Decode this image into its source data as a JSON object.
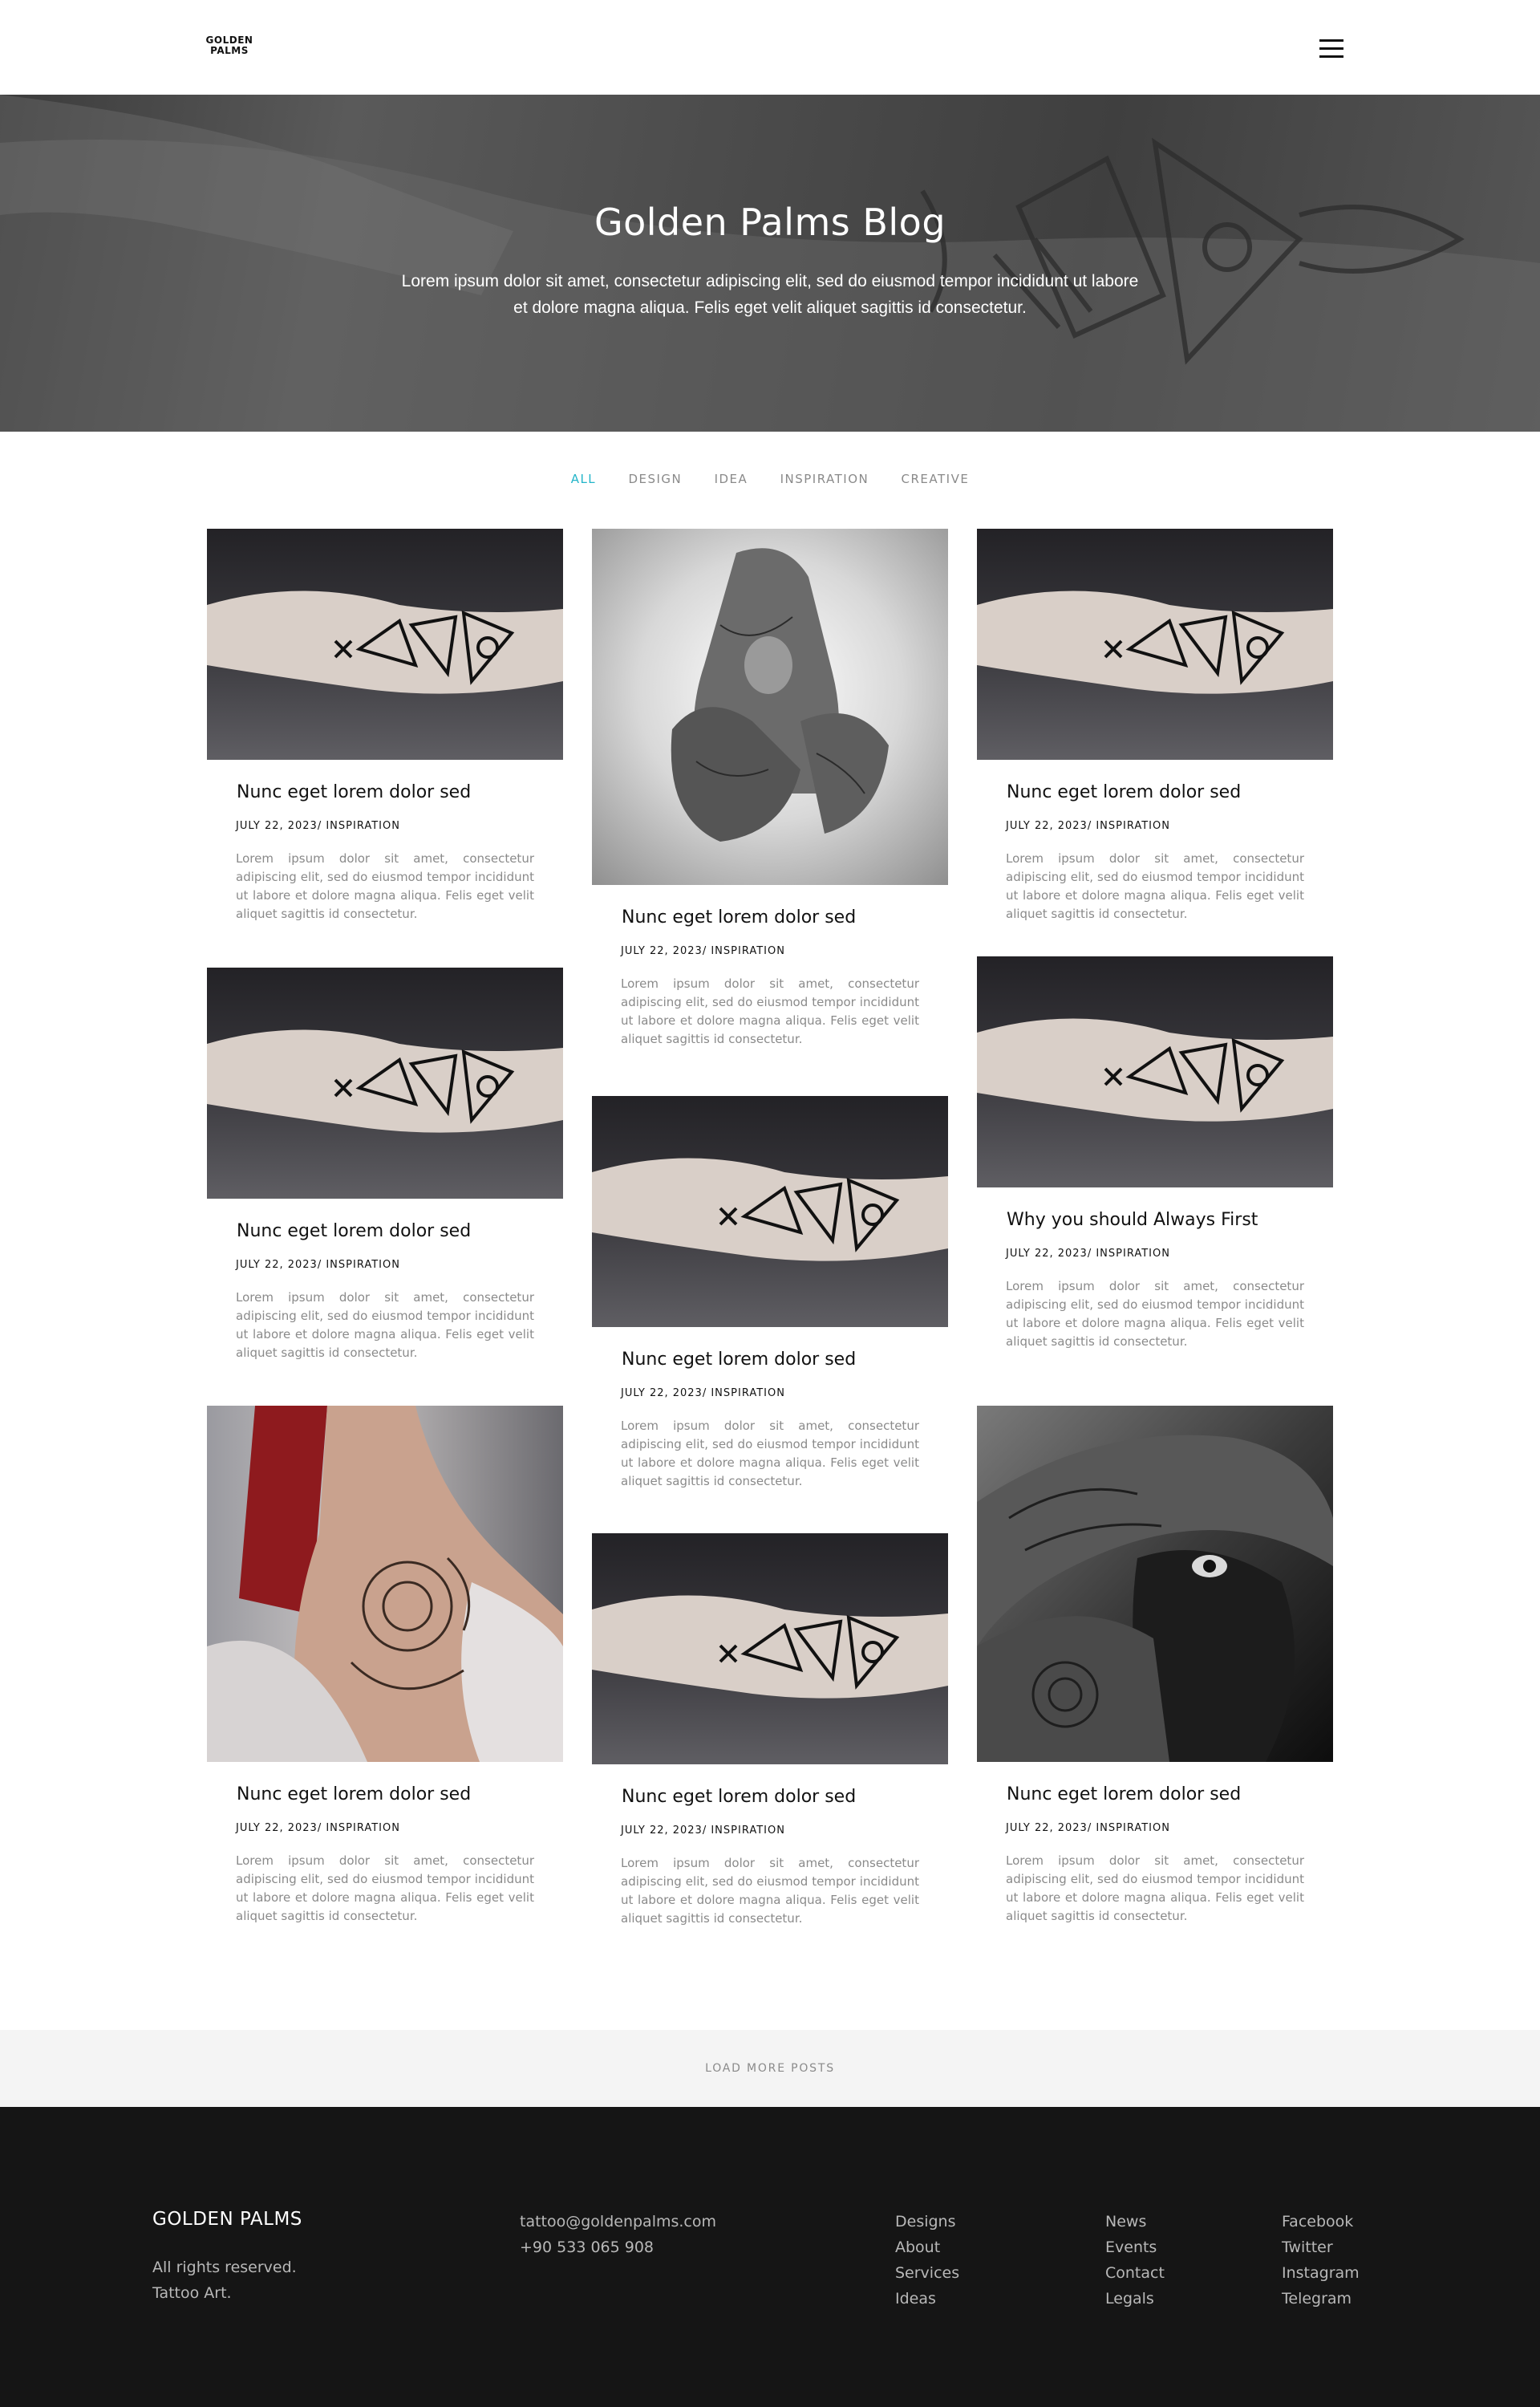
{
  "header": {
    "logo_line1": "GOLDEN",
    "logo_line2": "PALMS",
    "menu_icon": "hamburger-menu-icon"
  },
  "hero": {
    "title": "Golden Palms Blog",
    "subtitle": "Lorem ipsum dolor sit amet, consectetur adipiscing elit, sed do eiusmod tempor incididunt ut labore et dolore magna aliqua. Felis eget velit aliquet sagittis id consectetur."
  },
  "filters": [
    {
      "label": "ALL",
      "active": true
    },
    {
      "label": "DESIGN",
      "active": false
    },
    {
      "label": "IDEA",
      "active": false
    },
    {
      "label": "INSPIRATION",
      "active": false
    },
    {
      "label": "CREATIVE",
      "active": false
    }
  ],
  "posts": [
    {
      "title": "Nunc eget lorem dolor sed",
      "meta": "JULY 22, 2023/ INSPIRATION",
      "excerpt": "Lorem ipsum dolor sit amet, consectetur adipiscing elit, sed do eiusmod tempor incididunt ut labore et dolore magna aliqua. Felis eget velit aliquet sagittis id consectetur.",
      "image": "forearm-tattoo-photo"
    },
    {
      "title": "Nunc eget lorem dolor sed",
      "meta": "JULY 22, 2023/ INSPIRATION",
      "excerpt": "Lorem ipsum dolor sit amet, consectetur adipiscing elit, sed do eiusmod tempor incididunt ut labore et dolore magna aliqua. Felis eget velit aliquet sagittis id consectetur.",
      "image": "tattooed-arms-portrait-photo"
    },
    {
      "title": "Nunc eget lorem dolor sed",
      "meta": "JULY 22, 2023/ INSPIRATION",
      "excerpt": "Lorem ipsum dolor sit amet, consectetur adipiscing elit, sed do eiusmod tempor incididunt ut labore et dolore magna aliqua. Felis eget velit aliquet sagittis id consectetur.",
      "image": "forearm-tattoo-photo"
    },
    {
      "title": "Nunc eget lorem dolor sed",
      "meta": "JULY 22, 2023/ INSPIRATION",
      "excerpt": "Lorem ipsum dolor sit amet, consectetur adipiscing elit, sed do eiusmod tempor incididunt ut labore et dolore magna aliqua. Felis eget velit aliquet sagittis id consectetur.",
      "image": "forearm-tattoo-photo"
    },
    {
      "title": "Nunc eget lorem dolor sed",
      "meta": "JULY 22, 2023/ INSPIRATION",
      "excerpt": "Lorem ipsum dolor sit amet, consectetur adipiscing elit, sed do eiusmod tempor incididunt ut labore et dolore magna aliqua. Felis eget velit aliquet sagittis id consectetur.",
      "image": "forearm-tattoo-photo"
    },
    {
      "title": "Why you should Always First",
      "meta": "JULY 22, 2023/ INSPIRATION",
      "excerpt": "Lorem ipsum dolor sit amet, consectetur adipiscing elit, sed do eiusmod tempor incididunt ut labore et dolore magna aliqua. Felis eget velit aliquet sagittis id consectetur.",
      "image": "forearm-tattoo-photo"
    },
    {
      "title": "Nunc eget lorem dolor sed",
      "meta": "JULY 22, 2023/ INSPIRATION",
      "excerpt": "Lorem ipsum dolor sit amet, consectetur adipiscing elit, sed do eiusmod tempor incididunt ut labore et dolore magna aliqua. Felis eget velit aliquet sagittis id consectetur.",
      "image": "shoulder-rose-tattoo-photo"
    },
    {
      "title": "Nunc eget lorem dolor sed",
      "meta": "JULY 22, 2023/ INSPIRATION",
      "excerpt": "Lorem ipsum dolor sit amet, consectetur adipiscing elit, sed do eiusmod tempor incididunt ut labore et dolore magna aliqua. Felis eget velit aliquet sagittis id consectetur.",
      "image": "forearm-tattoo-photo"
    },
    {
      "title": "Nunc eget lorem dolor sed",
      "meta": "JULY 22, 2023/ INSPIRATION",
      "excerpt": "Lorem ipsum dolor sit amet, consectetur adipiscing elit, sed do eiusmod tempor incididunt ut labore et dolore magna aliqua. Felis eget velit aliquet sagittis id consectetur.",
      "image": "tattooed-man-portrait-photo"
    }
  ],
  "load_more": "LOAD MORE POSTS",
  "footer": {
    "brand": "GOLDEN PALMS",
    "rights_line1": "All rights reserved.",
    "rights_line2": "Tattoo Art.",
    "email": "tattoo@goldenpalms.com",
    "phone": "+90 533 065 908",
    "col1": [
      "Designs",
      "About",
      "Services",
      "Ideas"
    ],
    "col2": [
      "News",
      "Events",
      "Contact",
      "Legals"
    ],
    "col3": [
      "Facebook",
      "Twitter",
      "Instagram",
      "Telegram"
    ]
  }
}
